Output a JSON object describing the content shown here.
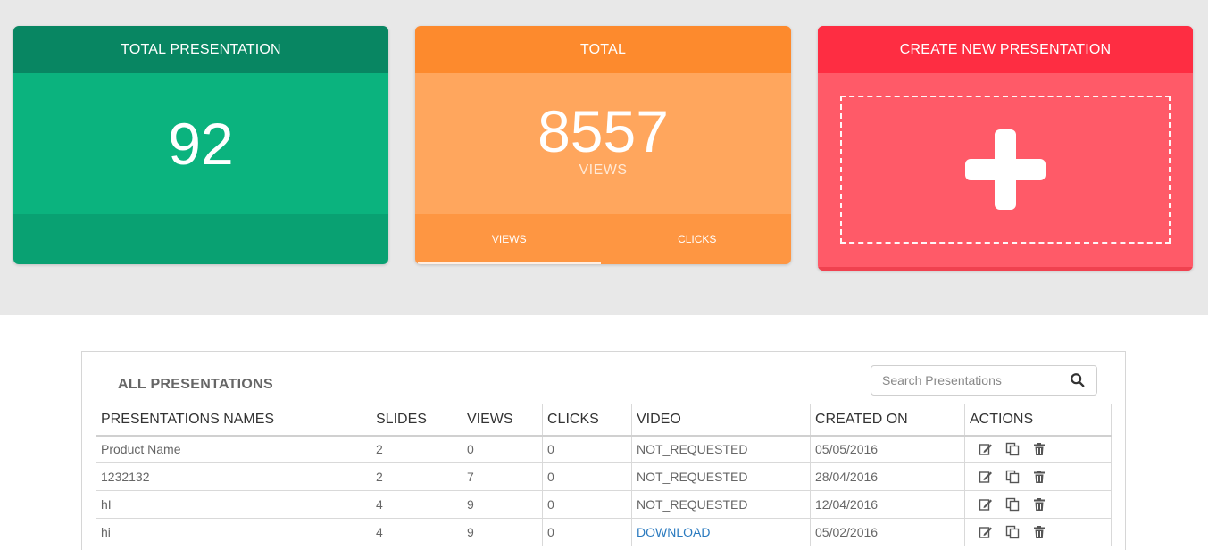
{
  "cards": {
    "total_presentation": {
      "title": "TOTAL PRESENTATION",
      "value": "92"
    },
    "total": {
      "title": "TOTAL",
      "value": "8557",
      "unit": "VIEWS",
      "tabs": [
        "VIEWS",
        "CLICKS"
      ]
    },
    "create": {
      "title": "CREATE NEW PRESENTATION"
    }
  },
  "panel": {
    "title": "ALL PRESENTATIONS",
    "search_placeholder": "Search Presentations",
    "columns": [
      "PRESENTATIONS NAMES",
      "SLIDES",
      "VIEWS",
      "CLICKS",
      "VIDEO",
      "CREATED ON",
      "ACTIONS"
    ],
    "rows": [
      {
        "name": "Product Name",
        "slides": "2",
        "views": "0",
        "clicks": "0",
        "video": "NOT_REQUESTED",
        "created": "05/05/2016"
      },
      {
        "name": "1232132",
        "slides": "2",
        "views": "7",
        "clicks": "0",
        "video": "NOT_REQUESTED",
        "created": "28/04/2016"
      },
      {
        "name": "hI",
        "slides": "4",
        "views": "9",
        "clicks": "0",
        "video": "NOT_REQUESTED",
        "created": "12/04/2016"
      },
      {
        "name": "hi",
        "slides": "4",
        "views": "9",
        "clicks": "0",
        "video": "DOWNLOAD",
        "created": "05/02/2016"
      }
    ],
    "action_icons": [
      "edit-icon",
      "copy-icon",
      "trash-icon"
    ]
  },
  "colors": {
    "green_head": "#088662",
    "green_body": "#0bb37e",
    "orange_head": "#fd8a2d",
    "orange_body": "#ffa65d",
    "red_head": "#fe2d42",
    "red_body": "#ff5a68",
    "link": "#2a7abf"
  }
}
